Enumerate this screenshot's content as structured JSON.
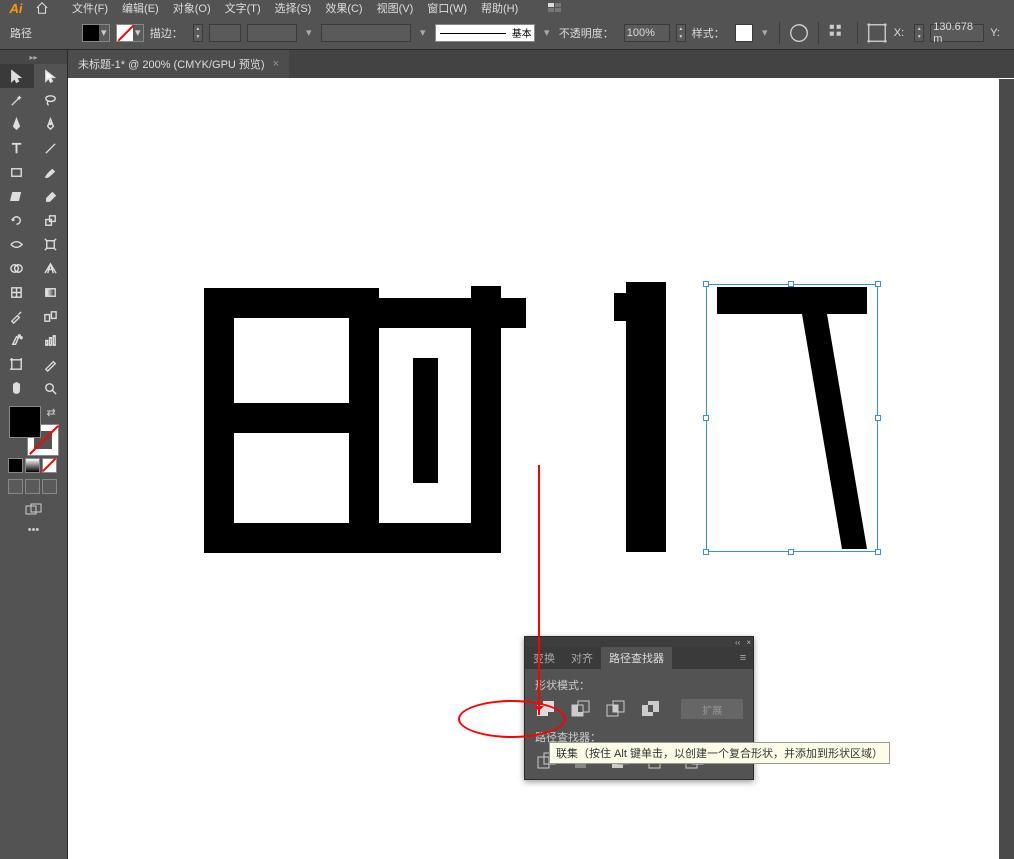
{
  "app": {
    "logo": "Ai"
  },
  "menu": {
    "file": "文件(F)",
    "edit": "编辑(E)",
    "object": "对象(O)",
    "type": "文字(T)",
    "select": "选择(S)",
    "effect": "效果(C)",
    "view": "视图(V)",
    "window": "窗口(W)",
    "help": "帮助(H)"
  },
  "control": {
    "label": "路径",
    "stroke_label": "描边：",
    "basic_label": "基本",
    "opacity_label": "不透明度：",
    "opacity_value": "100%",
    "style_label": "样式：",
    "x_label": "X:",
    "x_value": "130.678 m",
    "y_label": "Y:"
  },
  "tab": {
    "title": "未标题-1* @ 200% (CMYK/GPU 预览)"
  },
  "panel": {
    "tab_transform": "变换",
    "tab_align": "对齐",
    "tab_pathfinder": "路径查找器",
    "shape_modes_label": "形状模式：",
    "pathfinder_label": "路径查找器：",
    "expand_label": "扩展"
  },
  "tooltip": "联集（按住 Alt 键单击，以创建一个复合形状，并添加到形状区域）",
  "colors": {
    "accent": "#ff9a00",
    "panel_bg": "#535353",
    "selection": "#3a8fd6",
    "annotation": "#ff0000"
  }
}
